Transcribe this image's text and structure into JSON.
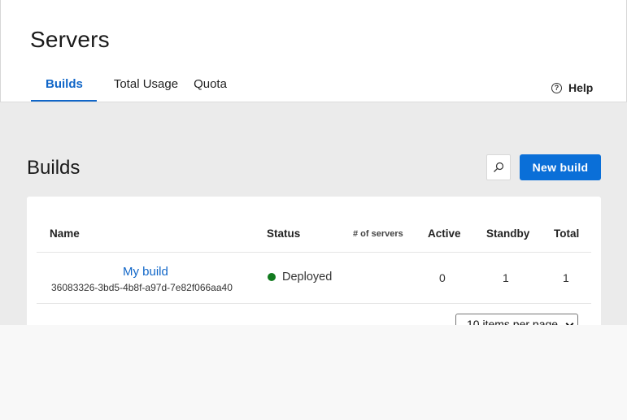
{
  "header": {
    "title": "Servers",
    "tabs": [
      {
        "label": "Builds",
        "active": true
      },
      {
        "label": "Total Usage",
        "active": false
      },
      {
        "label": "Quota",
        "active": false
      }
    ],
    "help_label": "Help",
    "help_icon": "?"
  },
  "main": {
    "section_title": "Builds",
    "search_icon": "search-icon",
    "new_build_label": "New build",
    "accent_color": "#0a6fd8"
  },
  "table": {
    "columns": [
      "Name",
      "Status",
      "# of servers",
      "Active",
      "Standby",
      "Total"
    ],
    "rows": [
      {
        "name": "My build",
        "id": "36083326-3bd5-4b8f-a97d-7e82f066aa40",
        "status": "Deployed",
        "status_color": "#117a1e",
        "servers": "",
        "active": "0",
        "standby": "1",
        "total": "1"
      }
    ],
    "page_size": "10 items per page"
  }
}
